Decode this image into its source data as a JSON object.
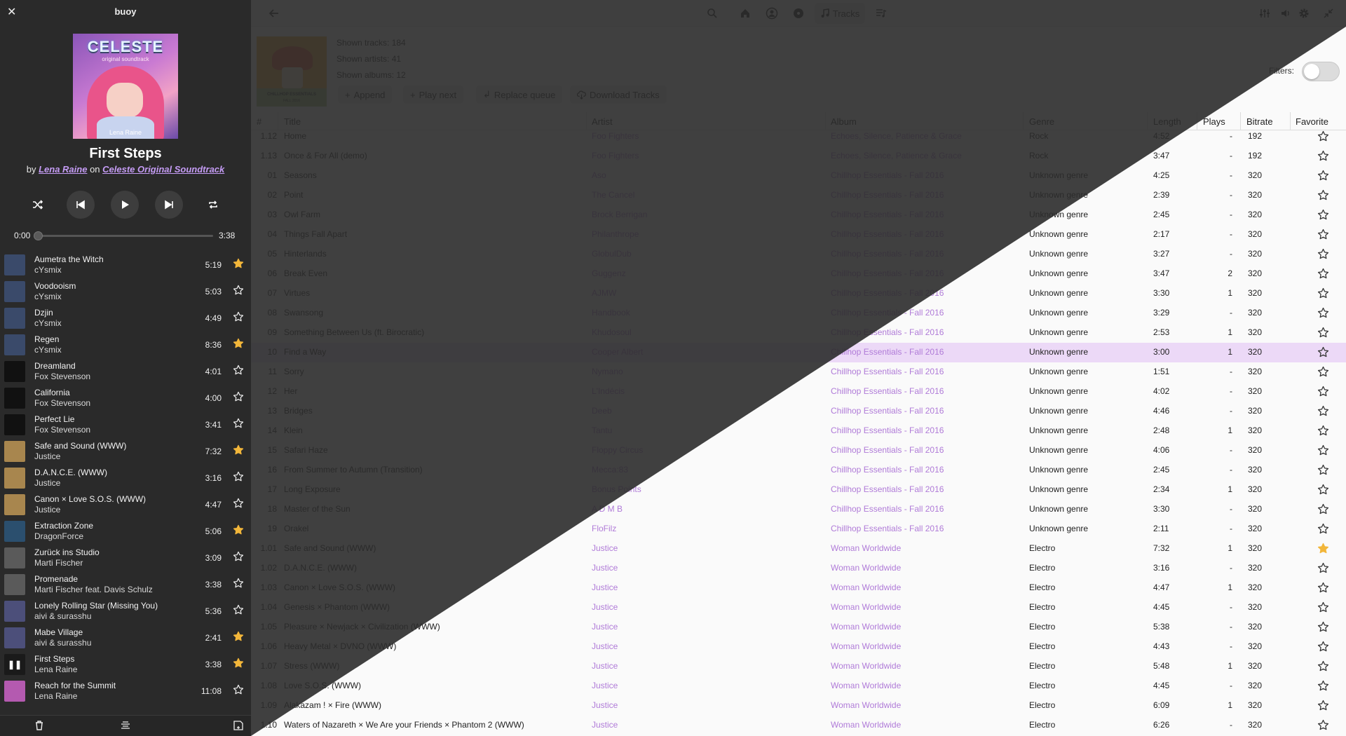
{
  "app_title": "buoy",
  "now_playing": {
    "title": "First Steps",
    "by_word": "by",
    "artist": "Lena Raine",
    "on_word": "on",
    "album": "Celeste Original Soundtrack",
    "time_current": "0:00",
    "time_total": "3:38",
    "progress": 0
  },
  "cover": {
    "logo": "CELESTE",
    "subtitle": "original soundtrack",
    "signature": "Lena Raine"
  },
  "queue": [
    {
      "title": "Aumetra the Witch",
      "artist": "cYsmix",
      "length": "5:19",
      "favorite": true,
      "thumb": "#3a4a6a"
    },
    {
      "title": "Voodooism",
      "artist": "cYsmix",
      "length": "5:03",
      "favorite": false,
      "thumb": "#3a4a6a"
    },
    {
      "title": "Dzjin",
      "artist": "cYsmix",
      "length": "4:49",
      "favorite": false,
      "thumb": "#3a4a6a"
    },
    {
      "title": "Regen",
      "artist": "cYsmix",
      "length": "8:36",
      "favorite": true,
      "thumb": "#3a4a6a"
    },
    {
      "title": "Dreamland",
      "artist": "Fox Stevenson",
      "length": "4:01",
      "favorite": false,
      "thumb": "#111111"
    },
    {
      "title": "California",
      "artist": "Fox Stevenson",
      "length": "4:00",
      "favorite": false,
      "thumb": "#111111"
    },
    {
      "title": "Perfect Lie",
      "artist": "Fox Stevenson",
      "length": "3:41",
      "favorite": false,
      "thumb": "#111111"
    },
    {
      "title": "Safe and Sound (WWW)",
      "artist": "Justice",
      "length": "7:32",
      "favorite": true,
      "thumb": "#a8864e"
    },
    {
      "title": "D.A.N.C.E. (WWW)",
      "artist": "Justice",
      "length": "3:16",
      "favorite": false,
      "thumb": "#a8864e"
    },
    {
      "title": "Canon × Love S.O.S. (WWW)",
      "artist": "Justice",
      "length": "4:47",
      "favorite": false,
      "thumb": "#a8864e"
    },
    {
      "title": "Extraction Zone",
      "artist": "DragonForce",
      "length": "5:06",
      "favorite": true,
      "thumb": "#2b4f6e"
    },
    {
      "title": "Zurück ins Studio",
      "artist": "Marti Fischer",
      "length": "3:09",
      "favorite": false,
      "thumb": "#5a5a5a"
    },
    {
      "title": "Promenade",
      "artist": "Marti Fischer feat. Davis Schulz",
      "length": "3:38",
      "favorite": false,
      "thumb": "#5a5a5a"
    },
    {
      "title": "Lonely Rolling Star (Missing You)",
      "artist": "aivi & surasshu",
      "length": "5:36",
      "favorite": false,
      "thumb": "#4c4f7a"
    },
    {
      "title": "Mabe Village",
      "artist": "aivi & surasshu",
      "length": "2:41",
      "favorite": true,
      "thumb": "#4c4f7a"
    },
    {
      "title": "First Steps",
      "artist": "Lena Raine",
      "length": "3:38",
      "favorite": true,
      "thumb": "playing"
    },
    {
      "title": "Reach for the Summit",
      "artist": "Lena Raine",
      "length": "11:08",
      "favorite": false,
      "thumb": "#b45ab0"
    }
  ],
  "topbar": {
    "active_tab": "Tracks"
  },
  "album_art": {
    "line1": "CHILLHOP ESSENTIALS",
    "line2": "FALL 2016"
  },
  "stats": {
    "tracks": "Shown tracks: 184",
    "artists": "Shown artists: 41",
    "albums": "Shown albums: 12"
  },
  "actions": {
    "append": "Append",
    "play_next": "Play next",
    "replace_queue": "Replace queue",
    "download": "Download Tracks"
  },
  "filters_label": "Filters:",
  "filters_on": false,
  "columns": {
    "num": "#",
    "title": "Title",
    "artist": "Artist",
    "album": "Album",
    "genre": "Genre",
    "length": "Length",
    "plays": "Plays",
    "bitrate": "Bitrate",
    "favorite": "Favorite"
  },
  "tracks": [
    {
      "num": "1.12",
      "title": "Home",
      "artist": "Foo Fighters",
      "album": "Echoes, Silence, Patience & Grace",
      "genre": "Rock",
      "length": "4:52",
      "plays": "-",
      "bitrate": "192",
      "fav": false
    },
    {
      "num": "1.13",
      "title": "Once & For All (demo)",
      "artist": "Foo Fighters",
      "album": "Echoes, Silence, Patience & Grace",
      "genre": "Rock",
      "length": "3:47",
      "plays": "-",
      "bitrate": "192",
      "fav": false
    },
    {
      "num": "01",
      "title": "Seasons",
      "artist": "Aso",
      "album": "Chillhop Essentials - Fall 2016",
      "genre": "Unknown genre",
      "length": "4:25",
      "plays": "-",
      "bitrate": "320",
      "fav": false
    },
    {
      "num": "02",
      "title": "Point",
      "artist": "The Cancel",
      "album": "Chillhop Essentials - Fall 2016",
      "genre": "Unknown genre",
      "length": "2:39",
      "plays": "-",
      "bitrate": "320",
      "fav": false
    },
    {
      "num": "03",
      "title": "Owl Farm",
      "artist": "Brock Berrigan",
      "album": "Chillhop Essentials - Fall 2016",
      "genre": "Unknown genre",
      "length": "2:45",
      "plays": "-",
      "bitrate": "320",
      "fav": false
    },
    {
      "num": "04",
      "title": "Things Fall Apart",
      "artist": "Philanthrope",
      "album": "Chillhop Essentials - Fall 2016",
      "genre": "Unknown genre",
      "length": "2:17",
      "plays": "-",
      "bitrate": "320",
      "fav": false
    },
    {
      "num": "05",
      "title": "Hinterlands",
      "artist": "GlobulDub",
      "album": "Chillhop Essentials - Fall 2016",
      "genre": "Unknown genre",
      "length": "3:27",
      "plays": "-",
      "bitrate": "320",
      "fav": false
    },
    {
      "num": "06",
      "title": "Break Even",
      "artist": "Guggenz",
      "album": "Chillhop Essentials - Fall 2016",
      "genre": "Unknown genre",
      "length": "3:47",
      "plays": "2",
      "bitrate": "320",
      "fav": false
    },
    {
      "num": "07",
      "title": "Virtues",
      "artist": "AJMW",
      "album": "Chillhop Essentials - Fall 2016",
      "genre": "Unknown genre",
      "length": "3:30",
      "plays": "1",
      "bitrate": "320",
      "fav": false
    },
    {
      "num": "08",
      "title": "Swansong",
      "artist": "Handbook",
      "album": "Chillhop Essentials - Fall 2016",
      "genre": "Unknown genre",
      "length": "3:29",
      "plays": "-",
      "bitrate": "320",
      "fav": false
    },
    {
      "num": "09",
      "title": "Something Between Us (ft. Birocratic)",
      "artist": "Khudosoul",
      "album": "Chillhop Essentials - Fall 2016",
      "genre": "Unknown genre",
      "length": "2:53",
      "plays": "1",
      "bitrate": "320",
      "fav": false
    },
    {
      "num": "10",
      "title": "Find a Way",
      "artist": "Cooper Albert",
      "album": "Chillhop Essentials - Fall 2016",
      "genre": "Unknown genre",
      "length": "3:00",
      "plays": "1",
      "bitrate": "320",
      "fav": false,
      "selected": true
    },
    {
      "num": "11",
      "title": "Sorry",
      "artist": "Nymano",
      "album": "Chillhop Essentials - Fall 2016",
      "genre": "Unknown genre",
      "length": "1:51",
      "plays": "-",
      "bitrate": "320",
      "fav": false
    },
    {
      "num": "12",
      "title": "Her",
      "artist": "L'Indécis",
      "album": "Chillhop Essentials - Fall 2016",
      "genre": "Unknown genre",
      "length": "4:02",
      "plays": "-",
      "bitrate": "320",
      "fav": false
    },
    {
      "num": "13",
      "title": "Bridges",
      "artist": "Deeb",
      "album": "Chillhop Essentials - Fall 2016",
      "genre": "Unknown genre",
      "length": "4:46",
      "plays": "-",
      "bitrate": "320",
      "fav": false
    },
    {
      "num": "14",
      "title": "Klein",
      "artist": "Tantu",
      "album": "Chillhop Essentials - Fall 2016",
      "genre": "Unknown genre",
      "length": "2:48",
      "plays": "1",
      "bitrate": "320",
      "fav": false
    },
    {
      "num": "15",
      "title": "Safari Haze",
      "artist": "Floppy Circus",
      "album": "Chillhop Essentials - Fall 2016",
      "genre": "Unknown genre",
      "length": "4:06",
      "plays": "-",
      "bitrate": "320",
      "fav": false
    },
    {
      "num": "16",
      "title": "From Summer to Autumn (Transition)",
      "artist": "Mecca:83",
      "album": "Chillhop Essentials - Fall 2016",
      "genre": "Unknown genre",
      "length": "2:45",
      "plays": "-",
      "bitrate": "320",
      "fav": false
    },
    {
      "num": "17",
      "title": "Long Exposure",
      "artist": "Bonus Points",
      "album": "Chillhop Essentials - Fall 2016",
      "genre": "Unknown genre",
      "length": "2:34",
      "plays": "1",
      "bitrate": "320",
      "fav": false
    },
    {
      "num": "18",
      "title": "Master of the Sun",
      "artist": "A D M B",
      "album": "Chillhop Essentials - Fall 2016",
      "genre": "Unknown genre",
      "length": "3:30",
      "plays": "-",
      "bitrate": "320",
      "fav": false
    },
    {
      "num": "19",
      "title": "Orakel",
      "artist": "FloFilz",
      "album": "Chillhop Essentials - Fall 2016",
      "genre": "Unknown genre",
      "length": "2:11",
      "plays": "-",
      "bitrate": "320",
      "fav": false
    },
    {
      "num": "1.01",
      "title": "Safe and Sound (WWW)",
      "artist": "Justice",
      "album": "Woman Worldwide",
      "genre": "Electro",
      "length": "7:32",
      "plays": "1",
      "bitrate": "320",
      "fav": true
    },
    {
      "num": "1.02",
      "title": "D.A.N.C.E. (WWW)",
      "artist": "Justice",
      "album": "Woman Worldwide",
      "genre": "Electro",
      "length": "3:16",
      "plays": "-",
      "bitrate": "320",
      "fav": false
    },
    {
      "num": "1.03",
      "title": "Canon × Love S.O.S. (WWW)",
      "artist": "Justice",
      "album": "Woman Worldwide",
      "genre": "Electro",
      "length": "4:47",
      "plays": "1",
      "bitrate": "320",
      "fav": false
    },
    {
      "num": "1.04",
      "title": "Genesis × Phantom (WWW)",
      "artist": "Justice",
      "album": "Woman Worldwide",
      "genre": "Electro",
      "length": "4:45",
      "plays": "-",
      "bitrate": "320",
      "fav": false
    },
    {
      "num": "1.05",
      "title": "Pleasure × Newjack × Civilization (WWW)",
      "artist": "Justice",
      "album": "Woman Worldwide",
      "genre": "Electro",
      "length": "5:38",
      "plays": "-",
      "bitrate": "320",
      "fav": false
    },
    {
      "num": "1.06",
      "title": "Heavy Metal × DVNO (WWW)",
      "artist": "Justice",
      "album": "Woman Worldwide",
      "genre": "Electro",
      "length": "4:43",
      "plays": "-",
      "bitrate": "320",
      "fav": false
    },
    {
      "num": "1.07",
      "title": "Stress (WWW)",
      "artist": "Justice",
      "album": "Woman Worldwide",
      "genre": "Electro",
      "length": "5:48",
      "plays": "1",
      "bitrate": "320",
      "fav": false
    },
    {
      "num": "1.08",
      "title": "Love S.O.S. (WWW)",
      "artist": "Justice",
      "album": "Woman Worldwide",
      "genre": "Electro",
      "length": "4:45",
      "plays": "-",
      "bitrate": "320",
      "fav": false
    },
    {
      "num": "1.09",
      "title": "Alakazam ! × Fire (WWW)",
      "artist": "Justice",
      "album": "Woman Worldwide",
      "genre": "Electro",
      "length": "6:09",
      "plays": "1",
      "bitrate": "320",
      "fav": false
    },
    {
      "num": "1.10",
      "title": "Waters of Nazareth × We Are your Friends × Phantom 2 (WWW)",
      "artist": "Justice",
      "album": "Woman Worldwide",
      "genre": "Electro",
      "length": "6:26",
      "plays": "-",
      "bitrate": "320",
      "fav": false
    }
  ],
  "colors": {
    "accent": "#b07bd8",
    "accent_dark": "#c59cf5",
    "selection": "#ecd9f7",
    "selection_dark": "#6b4a94",
    "star_on": "#f2b63a",
    "sidebar_bg": "#2a2a2a",
    "main_bg": "#fafafa"
  },
  "icons": {
    "close": "close-icon",
    "back": "back-arrow-icon",
    "search": "search-icon",
    "home": "home-icon",
    "artist": "user-icon",
    "album": "disc-icon",
    "tracks": "music-note-icon",
    "playlist": "playlist-icon",
    "equalizer": "equalizer-icon",
    "volume": "volume-icon",
    "settings": "gear-icon",
    "restore": "restore-icon",
    "shuffle": "shuffle-icon",
    "previous": "previous-icon",
    "play": "play-icon",
    "next": "next-icon",
    "repeat": "repeat-icon",
    "star": "star-icon",
    "trash": "trash-icon",
    "queue": "queue-icon",
    "save": "save-icon"
  }
}
